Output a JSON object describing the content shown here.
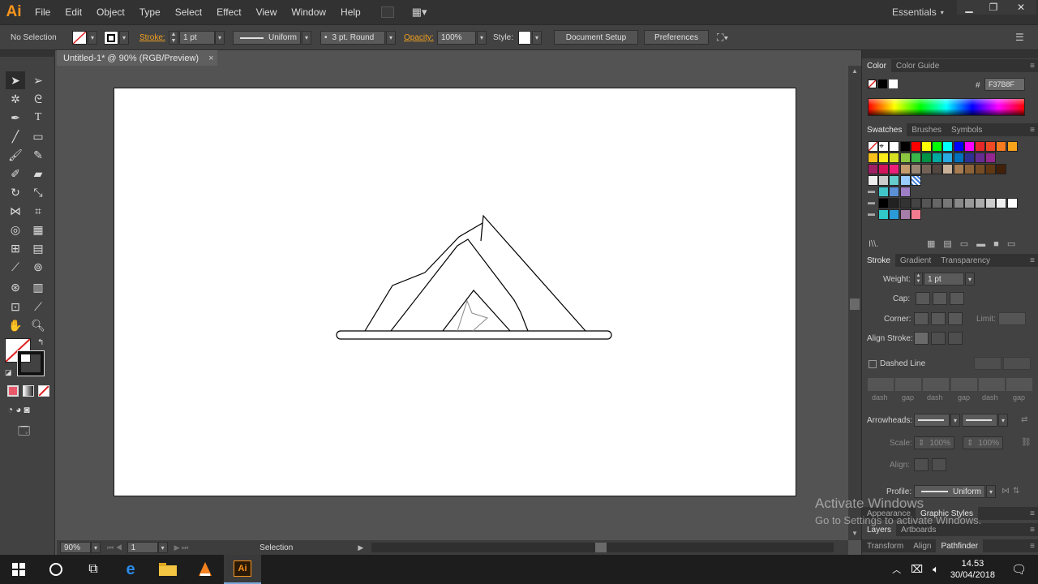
{
  "app": {
    "logo": "Ai",
    "workspace": "Essentials"
  },
  "menu": [
    "File",
    "Edit",
    "Object",
    "Type",
    "Select",
    "Effect",
    "View",
    "Window",
    "Help"
  ],
  "control": {
    "selection_label": "No Selection",
    "stroke_label": "Stroke:",
    "stroke_weight": "1 pt",
    "profile": "Uniform",
    "brush": "3 pt. Round",
    "opacity_label": "Opacity:",
    "opacity": "100%",
    "style_label": "Style:",
    "doc_setup": "Document Setup",
    "preferences": "Preferences"
  },
  "document": {
    "tab_title": "Untitled-1* @ 90% (RGB/Preview)",
    "close": "×"
  },
  "status": {
    "zoom": "90%",
    "artboard": "1",
    "tool": "Selection"
  },
  "color_panel": {
    "tabs": [
      "Color",
      "Color Guide"
    ],
    "hex_label": "#",
    "hex": "F37B8F"
  },
  "swatches_panel": {
    "tabs": [
      "Swatches",
      "Brushes",
      "Symbols"
    ]
  },
  "stroke_panel": {
    "tabs": [
      "Stroke",
      "Gradient",
      "Transparency"
    ],
    "weight_label": "Weight:",
    "weight": "1 pt",
    "cap_label": "Cap:",
    "corner_label": "Corner:",
    "limit_label": "Limit:",
    "align_label": "Align Stroke:",
    "dashed_label": "Dashed Line",
    "dash_labels": [
      "dash",
      "gap",
      "dash",
      "gap",
      "dash",
      "gap"
    ],
    "arrowheads_label": "Arrowheads:",
    "scale_label": "Scale:",
    "scale1": "100%",
    "scale2": "100%",
    "align2_label": "Align:",
    "profile_label": "Profile:",
    "profile": "Uniform"
  },
  "bottom_tabs": {
    "row1": [
      "Appearance",
      "Graphic Styles"
    ],
    "row2": [
      "Layers",
      "Artboards"
    ],
    "row3": [
      "Transform",
      "Align",
      "Pathfinder"
    ]
  },
  "watermark": {
    "line1": "Activate Windows",
    "line2": "Go to Settings to activate Windows."
  },
  "taskbar": {
    "time": "14.53",
    "date": "30/04/2018",
    "app_label": "Ai"
  },
  "colors": {
    "accent": "#f7941d",
    "fill_swatch": "#F37B8F"
  }
}
